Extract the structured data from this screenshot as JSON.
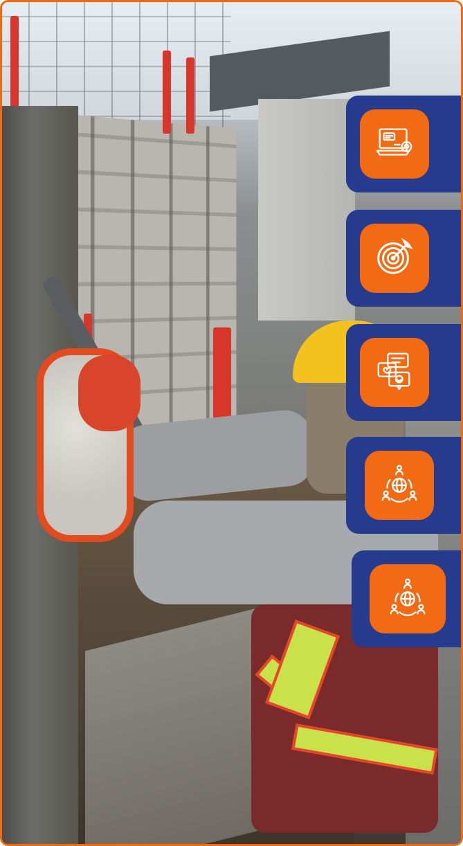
{
  "brand": {
    "accent": "#f26a13",
    "panel": "#263b8e",
    "frame": "#f06a12"
  },
  "cards": [
    {
      "icon": "laptop-chat-icon"
    },
    {
      "icon": "target-arrow-icon"
    },
    {
      "icon": "chat-feedback-icon"
    },
    {
      "icon": "global-network-icon"
    },
    {
      "icon": "global-network-icon"
    }
  ]
}
